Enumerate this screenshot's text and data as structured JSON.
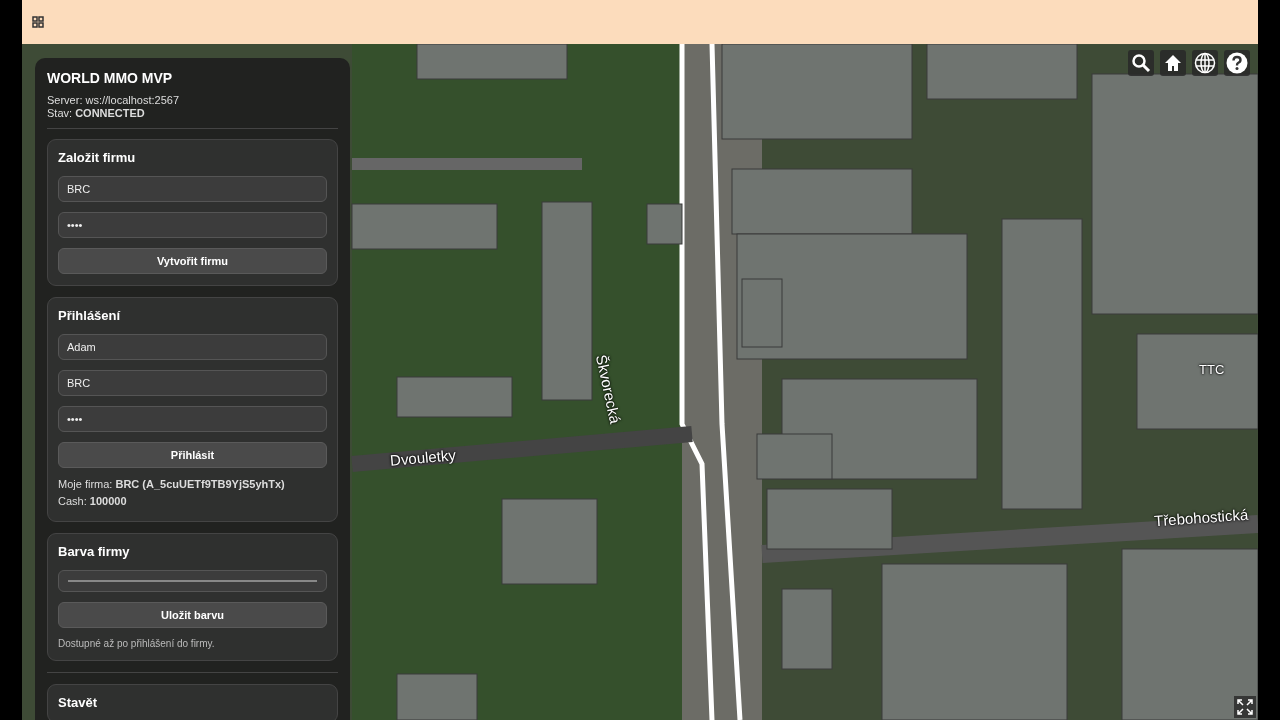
{
  "app": {
    "title": "WORLD MMO MVP",
    "server": "Server: ws://localhost:2567",
    "status": "Stav: **CONNECTED**"
  },
  "sections": [
    {
      "kind": "form",
      "title": "Založit firmu",
      "fields": [
        {
          "value": "BRC"
        },
        {
          "value": "••••"
        }
      ],
      "button": "Vytvořit firmu"
    },
    {
      "kind": "form",
      "title": "Přihlášení",
      "fields": [
        {
          "value": "Adam"
        },
        {
          "value": "BRC"
        },
        {
          "value": "••••"
        }
      ],
      "button": "Přihlásit",
      "info": [
        "Moje firma: **BRC (A_5cuUETf9TB9YjS5yhTx)**",
        "Cash: **100000**"
      ]
    },
    {
      "kind": "color",
      "title": "Barva firmy",
      "button": "Uložit barvu",
      "note": "Dostupné až po přihlášení do firmy."
    },
    {
      "kind": "form",
      "title": "Stavět"
    }
  ],
  "map_labels": [
    {
      "text": "Škvorecká",
      "kind": "vertical"
    },
    {
      "text": "Dvouletky",
      "kind": "street"
    },
    {
      "text": "Třebohostická",
      "kind": "street"
    },
    {
      "text": "TTC",
      "kind": "place"
    }
  ]
}
